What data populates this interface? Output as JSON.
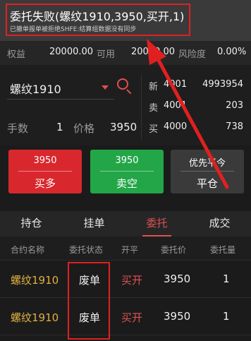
{
  "banner": {
    "title": "委托失败(螺纹1910,3950,买开,1)",
    "subtitle": "已撤单报单被拒绝SHFE:结算组数据没有同步"
  },
  "equity": {
    "label": "权益",
    "value": "20000.00",
    "available_label": "可用",
    "available_value": "20000.00",
    "risk_label": "风险度",
    "risk_value": "0.00%"
  },
  "order_form": {
    "contract": "螺纹1910",
    "qty_label": "手数",
    "qty_value": "1",
    "price_label": "价格",
    "price_value": "3950"
  },
  "depth": [
    {
      "label": "新",
      "price": "4001",
      "volume": "4993954"
    },
    {
      "label": "卖",
      "price": "4001",
      "volume": "203"
    },
    {
      "label": "买",
      "price": "4000",
      "volume": "738"
    }
  ],
  "buttons": {
    "buy": {
      "price": "3950",
      "action": "买多"
    },
    "sell": {
      "price": "3950",
      "action": "卖空"
    },
    "close": {
      "price": "优先平今",
      "action": "平仓"
    }
  },
  "tabs": [
    "持仓",
    "挂单",
    "委托",
    "成交"
  ],
  "active_tab": "委托",
  "table": {
    "headers": [
      "合约名称",
      "委托状态",
      "开平",
      "委托价",
      "委托量"
    ],
    "rows": [
      {
        "name": "螺纹1910",
        "status": "废单",
        "oc": "买开",
        "price": "3950",
        "qty": "1"
      },
      {
        "name": "螺纹1910",
        "status": "废单",
        "oc": "买开",
        "price": "3950",
        "qty": "1"
      }
    ]
  },
  "colors": {
    "accent": "#e05050",
    "buy": "#d8282e",
    "sell": "#23a648",
    "annotation": "#e02020"
  }
}
